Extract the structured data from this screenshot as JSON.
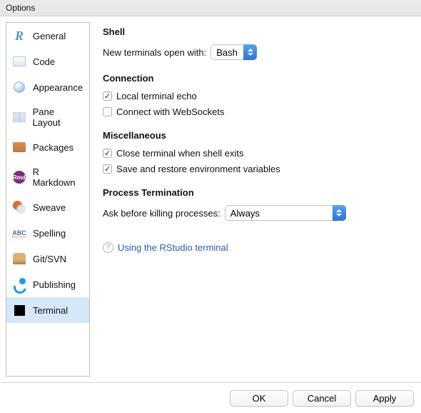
{
  "window": {
    "title": "Options"
  },
  "sidebar": {
    "items": [
      {
        "label": "General"
      },
      {
        "label": "Code"
      },
      {
        "label": "Appearance"
      },
      {
        "label": "Pane Layout"
      },
      {
        "label": "Packages"
      },
      {
        "label": "R Markdown"
      },
      {
        "label": "Sweave"
      },
      {
        "label": "Spelling"
      },
      {
        "label": "Git/SVN"
      },
      {
        "label": "Publishing"
      },
      {
        "label": "Terminal"
      }
    ],
    "selected_index": 10
  },
  "shell": {
    "heading": "Shell",
    "open_with_label": "New terminals open with:",
    "open_with_value": "Bash"
  },
  "connection": {
    "heading": "Connection",
    "echo": {
      "label": "Local terminal echo",
      "checked": true
    },
    "websockets": {
      "label": "Connect with WebSockets",
      "checked": false
    }
  },
  "misc": {
    "heading": "Miscellaneous",
    "close_on_exit": {
      "label": "Close terminal when shell exits",
      "checked": true
    },
    "save_env": {
      "label": "Save and restore environment variables",
      "checked": true
    }
  },
  "termination": {
    "heading": "Process Termination",
    "ask_label": "Ask before killing processes:",
    "ask_value": "Always"
  },
  "help": {
    "link_text": "Using the RStudio terminal"
  },
  "buttons": {
    "ok": "OK",
    "cancel": "Cancel",
    "apply": "Apply"
  }
}
